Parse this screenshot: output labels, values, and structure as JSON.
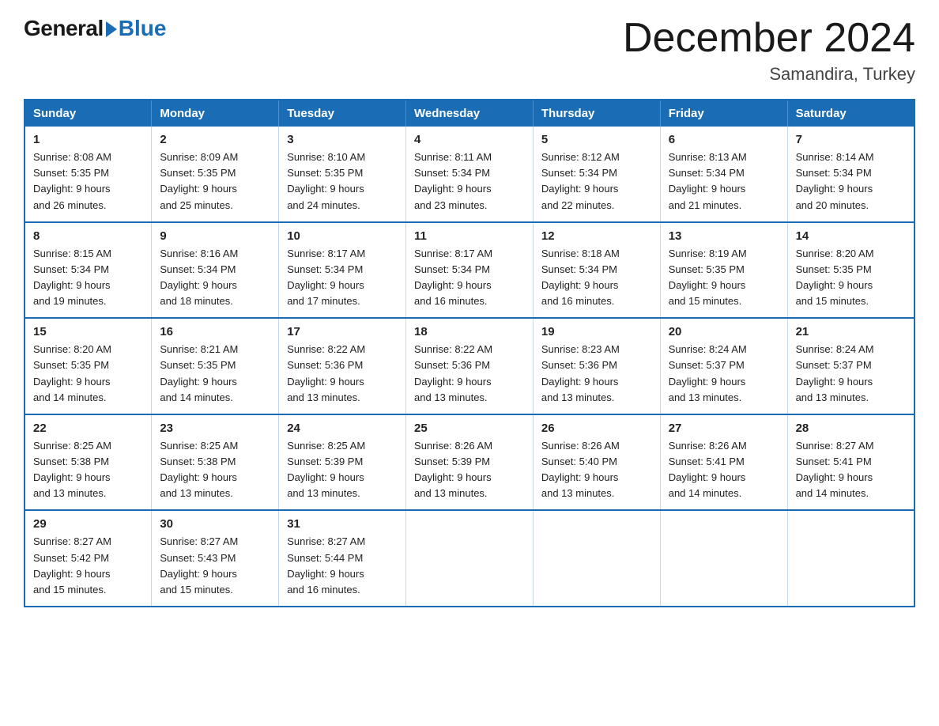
{
  "logo": {
    "general": "General",
    "blue": "Blue"
  },
  "title": "December 2024",
  "location": "Samandira, Turkey",
  "days_header": [
    "Sunday",
    "Monday",
    "Tuesday",
    "Wednesday",
    "Thursday",
    "Friday",
    "Saturday"
  ],
  "weeks": [
    [
      {
        "day": "1",
        "sunrise": "8:08 AM",
        "sunset": "5:35 PM",
        "daylight": "9 hours and 26 minutes."
      },
      {
        "day": "2",
        "sunrise": "8:09 AM",
        "sunset": "5:35 PM",
        "daylight": "9 hours and 25 minutes."
      },
      {
        "day": "3",
        "sunrise": "8:10 AM",
        "sunset": "5:35 PM",
        "daylight": "9 hours and 24 minutes."
      },
      {
        "day": "4",
        "sunrise": "8:11 AM",
        "sunset": "5:34 PM",
        "daylight": "9 hours and 23 minutes."
      },
      {
        "day": "5",
        "sunrise": "8:12 AM",
        "sunset": "5:34 PM",
        "daylight": "9 hours and 22 minutes."
      },
      {
        "day": "6",
        "sunrise": "8:13 AM",
        "sunset": "5:34 PM",
        "daylight": "9 hours and 21 minutes."
      },
      {
        "day": "7",
        "sunrise": "8:14 AM",
        "sunset": "5:34 PM",
        "daylight": "9 hours and 20 minutes."
      }
    ],
    [
      {
        "day": "8",
        "sunrise": "8:15 AM",
        "sunset": "5:34 PM",
        "daylight": "9 hours and 19 minutes."
      },
      {
        "day": "9",
        "sunrise": "8:16 AM",
        "sunset": "5:34 PM",
        "daylight": "9 hours and 18 minutes."
      },
      {
        "day": "10",
        "sunrise": "8:17 AM",
        "sunset": "5:34 PM",
        "daylight": "9 hours and 17 minutes."
      },
      {
        "day": "11",
        "sunrise": "8:17 AM",
        "sunset": "5:34 PM",
        "daylight": "9 hours and 16 minutes."
      },
      {
        "day": "12",
        "sunrise": "8:18 AM",
        "sunset": "5:34 PM",
        "daylight": "9 hours and 16 minutes."
      },
      {
        "day": "13",
        "sunrise": "8:19 AM",
        "sunset": "5:35 PM",
        "daylight": "9 hours and 15 minutes."
      },
      {
        "day": "14",
        "sunrise": "8:20 AM",
        "sunset": "5:35 PM",
        "daylight": "9 hours and 15 minutes."
      }
    ],
    [
      {
        "day": "15",
        "sunrise": "8:20 AM",
        "sunset": "5:35 PM",
        "daylight": "9 hours and 14 minutes."
      },
      {
        "day": "16",
        "sunrise": "8:21 AM",
        "sunset": "5:35 PM",
        "daylight": "9 hours and 14 minutes."
      },
      {
        "day": "17",
        "sunrise": "8:22 AM",
        "sunset": "5:36 PM",
        "daylight": "9 hours and 13 minutes."
      },
      {
        "day": "18",
        "sunrise": "8:22 AM",
        "sunset": "5:36 PM",
        "daylight": "9 hours and 13 minutes."
      },
      {
        "day": "19",
        "sunrise": "8:23 AM",
        "sunset": "5:36 PM",
        "daylight": "9 hours and 13 minutes."
      },
      {
        "day": "20",
        "sunrise": "8:24 AM",
        "sunset": "5:37 PM",
        "daylight": "9 hours and 13 minutes."
      },
      {
        "day": "21",
        "sunrise": "8:24 AM",
        "sunset": "5:37 PM",
        "daylight": "9 hours and 13 minutes."
      }
    ],
    [
      {
        "day": "22",
        "sunrise": "8:25 AM",
        "sunset": "5:38 PM",
        "daylight": "9 hours and 13 minutes."
      },
      {
        "day": "23",
        "sunrise": "8:25 AM",
        "sunset": "5:38 PM",
        "daylight": "9 hours and 13 minutes."
      },
      {
        "day": "24",
        "sunrise": "8:25 AM",
        "sunset": "5:39 PM",
        "daylight": "9 hours and 13 minutes."
      },
      {
        "day": "25",
        "sunrise": "8:26 AM",
        "sunset": "5:39 PM",
        "daylight": "9 hours and 13 minutes."
      },
      {
        "day": "26",
        "sunrise": "8:26 AM",
        "sunset": "5:40 PM",
        "daylight": "9 hours and 13 minutes."
      },
      {
        "day": "27",
        "sunrise": "8:26 AM",
        "sunset": "5:41 PM",
        "daylight": "9 hours and 14 minutes."
      },
      {
        "day": "28",
        "sunrise": "8:27 AM",
        "sunset": "5:41 PM",
        "daylight": "9 hours and 14 minutes."
      }
    ],
    [
      {
        "day": "29",
        "sunrise": "8:27 AM",
        "sunset": "5:42 PM",
        "daylight": "9 hours and 15 minutes."
      },
      {
        "day": "30",
        "sunrise": "8:27 AM",
        "sunset": "5:43 PM",
        "daylight": "9 hours and 15 minutes."
      },
      {
        "day": "31",
        "sunrise": "8:27 AM",
        "sunset": "5:44 PM",
        "daylight": "9 hours and 16 minutes."
      },
      null,
      null,
      null,
      null
    ]
  ],
  "labels": {
    "sunrise": "Sunrise: ",
    "sunset": "Sunset: ",
    "daylight": "Daylight: "
  }
}
